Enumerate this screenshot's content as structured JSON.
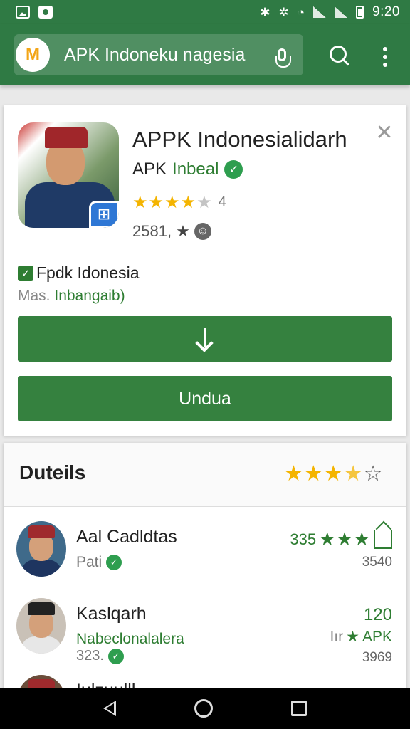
{
  "status_bar": {
    "time": "9:20",
    "icons": [
      "image-icon",
      "photo-icon",
      "bluetooth-icon",
      "vibrate-icon",
      "wifi-icon",
      "signal-icon",
      "signal-icon",
      "battery-icon"
    ]
  },
  "app_bar": {
    "logo_text": "M",
    "search_text": "APK Indoneku nagesia",
    "icons": [
      "mic-icon",
      "search-icon",
      "more-vert-icon"
    ]
  },
  "app": {
    "title": "APPK Indonesialidarh",
    "developer_a": "APK",
    "developer_b": "Inbeal",
    "rating_label": "4",
    "rating_value": 4,
    "rating_max": 5,
    "review_count": "2581,",
    "check_text": "Fpdk Idonesia",
    "sub_a": "Mas.",
    "sub_b": "Inbangaib)",
    "install_label": "Undua",
    "accent_color": "#35813f"
  },
  "details": {
    "title": "Duteils",
    "rating_value": 3.5,
    "items": [
      {
        "name": "Aal Cadldtas",
        "sub": "Pati",
        "score": "335",
        "count": "3540"
      },
      {
        "name": "Kaslqarh",
        "sub": "Nabeclonalalera",
        "sub2": "323.",
        "score": "120",
        "apk_prefix": "Iır",
        "apk_label": "APK",
        "count": "3969"
      },
      {
        "name": "Iulzuulll"
      }
    ]
  }
}
